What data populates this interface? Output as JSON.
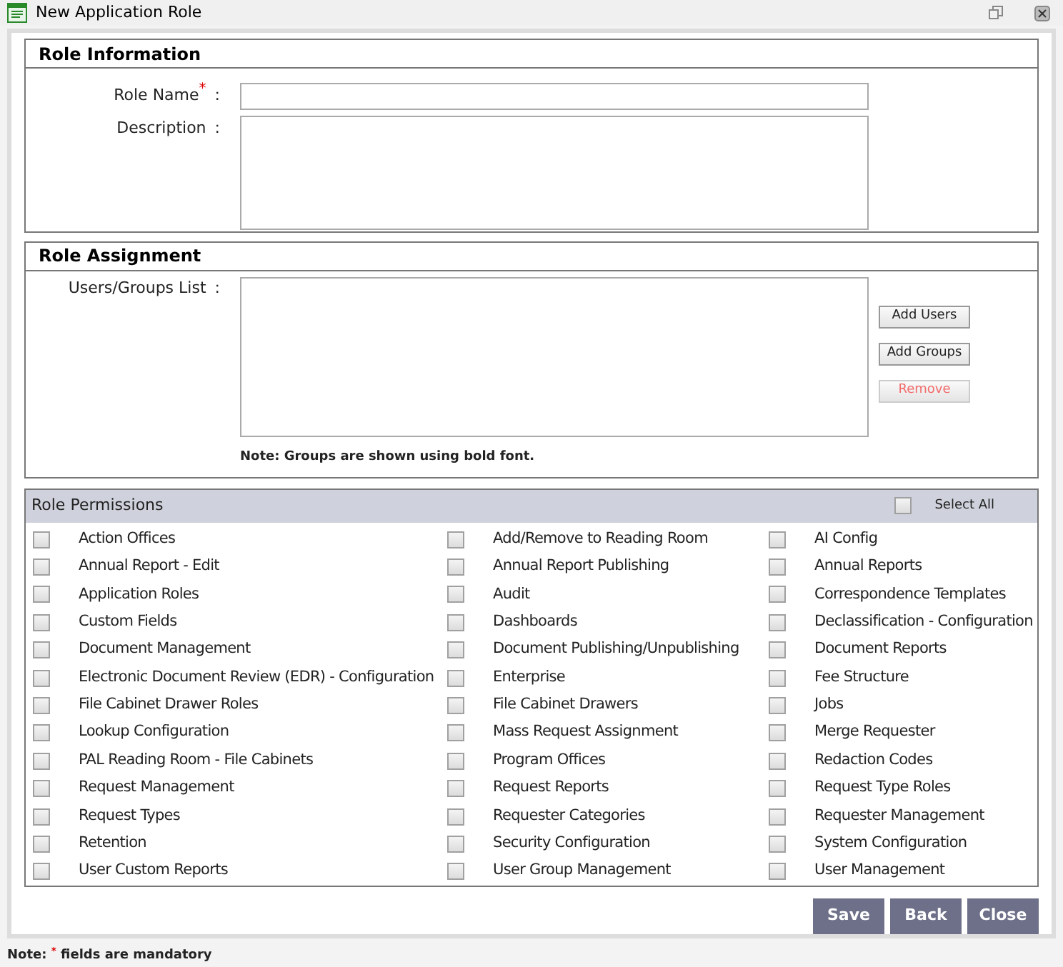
{
  "window": {
    "title": "New Application Role"
  },
  "role_information": {
    "title": "Role Information",
    "fields": [
      {
        "kind": "input",
        "label": "Role Name",
        "required_mark": "*",
        "colon": ":"
      },
      {
        "kind": "textarea",
        "label": "Description",
        "colon": ":"
      }
    ]
  },
  "role_assignment": {
    "title": "Role Assignment",
    "label": "Users/Groups List",
    "colon": ":",
    "note": "Note: Groups are shown using bold font.",
    "buttons": [
      {
        "label": "Add Users",
        "disabled": false
      },
      {
        "label": "Add Groups",
        "disabled": false
      },
      {
        "label": "Remove",
        "disabled": true
      }
    ]
  },
  "role_permissions": {
    "title": "Role Permissions",
    "select_all": {
      "label": "Select All",
      "checked": false
    },
    "items": [
      {
        "label": "Action Offices",
        "checked": false
      },
      {
        "label": "Add/Remove to Reading Room",
        "checked": false
      },
      {
        "label": "AI Config",
        "checked": false
      },
      {
        "label": "Annual Report - Edit",
        "checked": false
      },
      {
        "label": "Annual Report Publishing",
        "checked": false
      },
      {
        "label": "Annual Reports",
        "checked": false
      },
      {
        "label": "Application Roles",
        "checked": false
      },
      {
        "label": "Audit",
        "checked": false
      },
      {
        "label": "Correspondence Templates",
        "checked": false
      },
      {
        "label": "Custom Fields",
        "checked": false
      },
      {
        "label": "Dashboards",
        "checked": false
      },
      {
        "label": "Declassification - Configuration",
        "checked": false
      },
      {
        "label": "Document Management",
        "checked": false
      },
      {
        "label": "Document Publishing/Unpublishing",
        "checked": false
      },
      {
        "label": "Document Reports",
        "checked": false
      },
      {
        "label": "Electronic Document Review (EDR) - Configuration",
        "checked": false
      },
      {
        "label": "Enterprise",
        "checked": false
      },
      {
        "label": "Fee Structure",
        "checked": false
      },
      {
        "label": "File Cabinet Drawer Roles",
        "checked": false
      },
      {
        "label": "File Cabinet Drawers",
        "checked": false
      },
      {
        "label": "Jobs",
        "checked": false
      },
      {
        "label": "Lookup Configuration",
        "checked": false
      },
      {
        "label": "Mass Request Assignment",
        "checked": false
      },
      {
        "label": "Merge Requester",
        "checked": false
      },
      {
        "label": "PAL Reading Room - File Cabinets",
        "checked": false
      },
      {
        "label": "Program Offices",
        "checked": false
      },
      {
        "label": "Redaction Codes",
        "checked": false
      },
      {
        "label": "Request Management",
        "checked": false
      },
      {
        "label": "Request Reports",
        "checked": false
      },
      {
        "label": "Request Type Roles",
        "checked": false
      },
      {
        "label": "Request Types",
        "checked": false
      },
      {
        "label": "Requester Categories",
        "checked": false
      },
      {
        "label": "Requester Management",
        "checked": false
      },
      {
        "label": "Retention",
        "checked": false
      },
      {
        "label": "Security Configuration",
        "checked": false
      },
      {
        "label": "System Configuration",
        "checked": false
      },
      {
        "label": "User Custom Reports",
        "checked": false
      },
      {
        "label": "User Group Management",
        "checked": false
      },
      {
        "label": "User Management",
        "checked": false
      }
    ]
  },
  "actions": [
    "Save",
    "Back",
    "Close"
  ],
  "footer_note": {
    "prefix": "Note:",
    "mark": "*",
    "text": "fields are mandatory"
  }
}
